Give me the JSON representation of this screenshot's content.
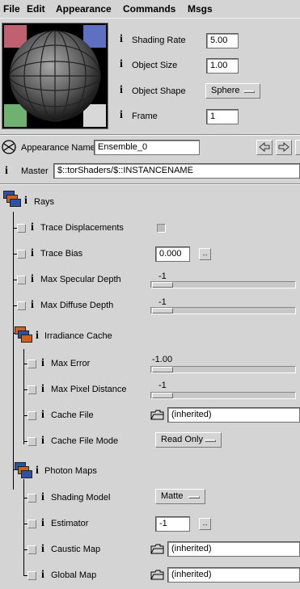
{
  "menu": [
    "File",
    "Edit",
    "Appearance",
    "Commands",
    "Msgs"
  ],
  "preview": {
    "params": [
      {
        "label": "Shading Rate",
        "value": "5.00",
        "kind": "field"
      },
      {
        "label": "Object Size",
        "value": "1.00",
        "kind": "field"
      },
      {
        "label": "Object Shape",
        "value": "Sphere",
        "kind": "menu"
      },
      {
        "label": "Frame",
        "value": "1",
        "kind": "field"
      }
    ]
  },
  "appearance": {
    "name_label": "Appearance Name",
    "name_value": "Ensemble_0",
    "master_label": "Master",
    "master_value": "$::torShaders/$::INSTANCENAME"
  },
  "rays": {
    "title": "Rays",
    "trace_displacements": {
      "label": "Trace Displacements"
    },
    "trace_bias": {
      "label": "Trace Bias",
      "value": "0.000"
    },
    "max_specular_depth": {
      "label": "Max Specular Depth",
      "value": "-1"
    },
    "max_diffuse_depth": {
      "label": "Max Diffuse Depth",
      "value": "-1"
    }
  },
  "irradiance": {
    "title": "Irradiance Cache",
    "max_error": {
      "label": "Max Error",
      "value": "-1.00"
    },
    "max_pixel_distance": {
      "label": "Max Pixel Distance",
      "value": "-1"
    },
    "cache_file": {
      "label": "Cache File",
      "value": "(inherited)"
    },
    "cache_file_mode": {
      "label": "Cache File Mode",
      "value": "Read Only"
    }
  },
  "photon": {
    "title": "Photon Maps",
    "shading_model": {
      "label": "Shading Model",
      "value": "Matte"
    },
    "estimator": {
      "label": "Estimator",
      "value": "-1"
    },
    "caustic_map": {
      "label": "Caustic Map",
      "value": "(inherited)"
    },
    "global_map": {
      "label": "Global Map",
      "value": "(inherited)"
    }
  },
  "colors": {
    "background": "#d4d4d4",
    "field_bg": "#ffffff",
    "folder_blue": "#3050a0",
    "folder_orange": "#d06020"
  }
}
